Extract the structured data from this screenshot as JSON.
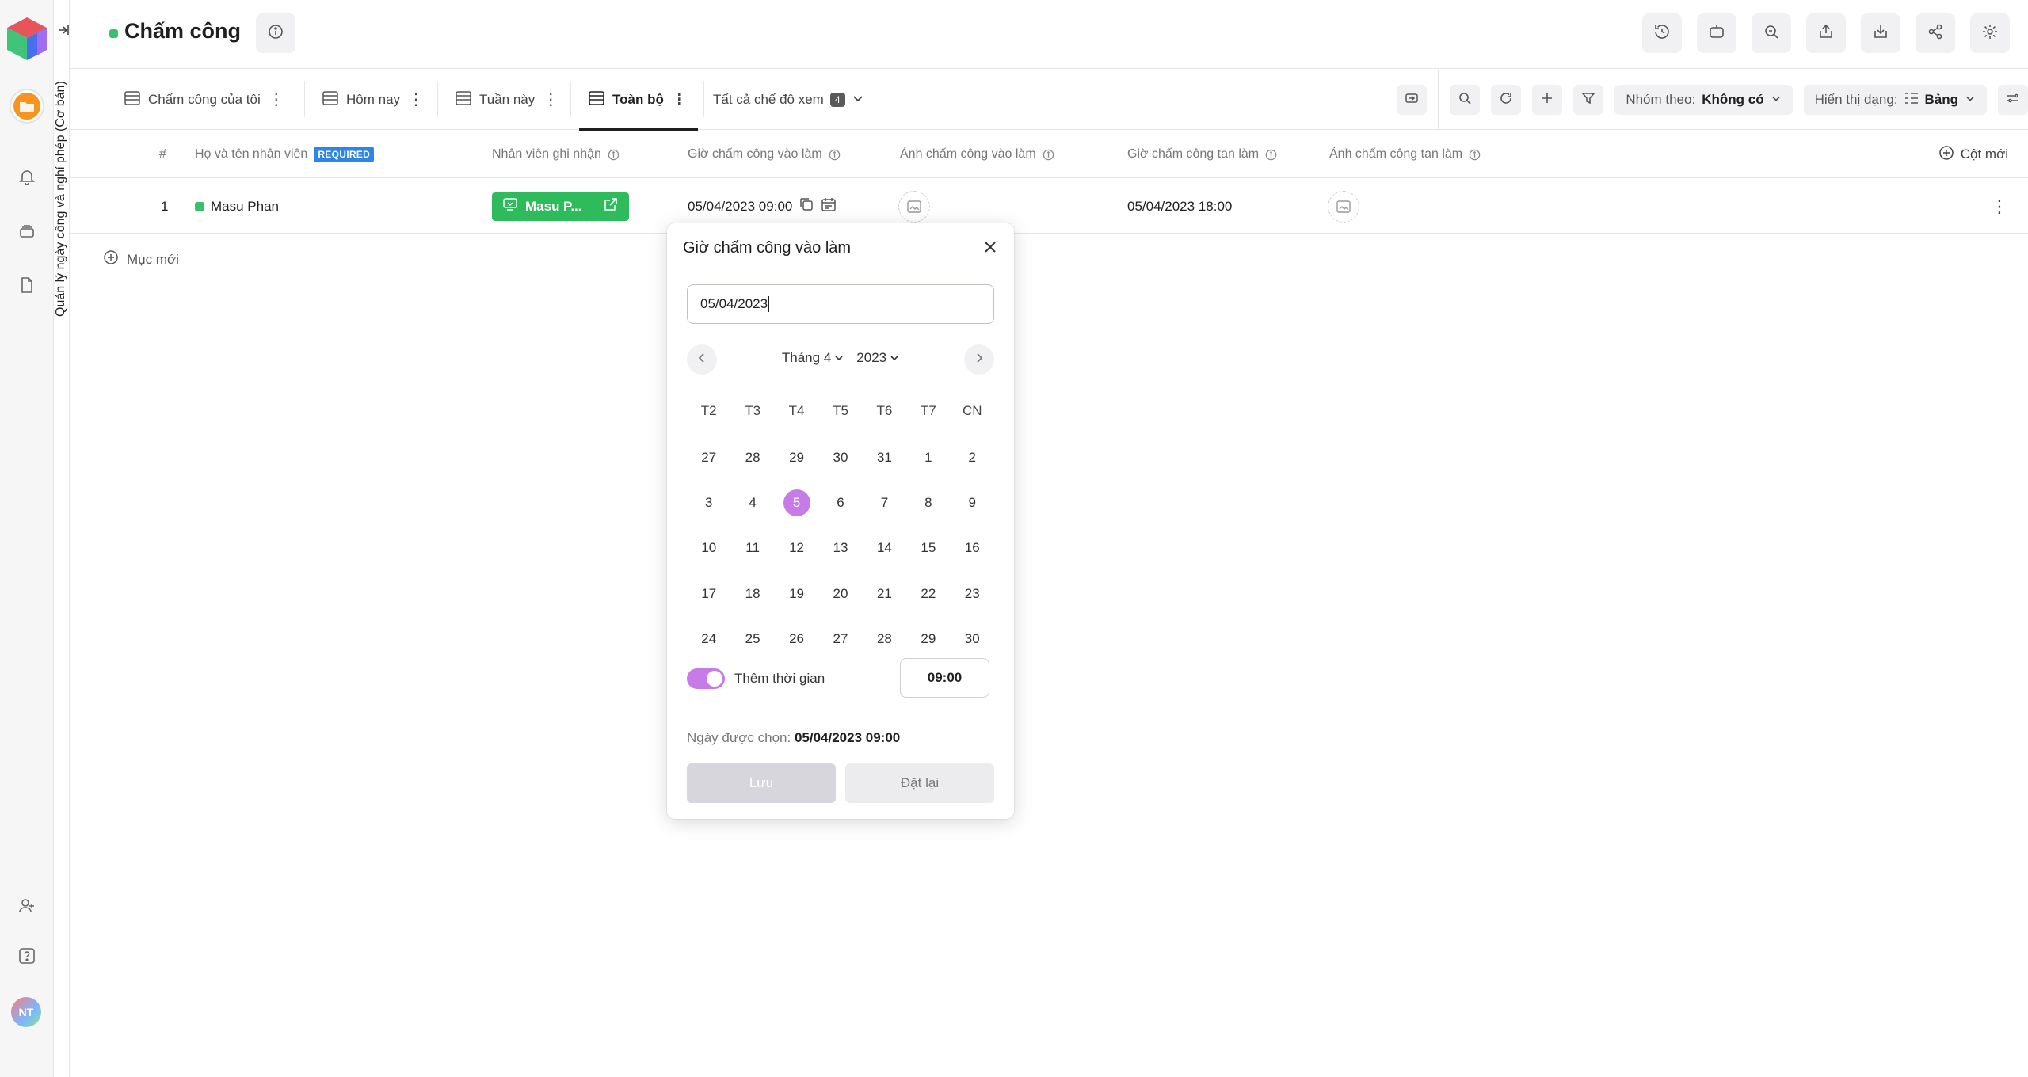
{
  "app": {
    "page_title": "Chấm công",
    "sidebar_vertical_title": "Quản lý ngày công và nghỉ phép (Cơ bản)",
    "avatar_initials": "NT"
  },
  "views": {
    "tabs": [
      {
        "label": "Chấm công của tôi"
      },
      {
        "label": "Hôm nay"
      },
      {
        "label": "Tuần này"
      },
      {
        "label": "Toàn bộ"
      }
    ],
    "all_views_label": "Tất cả chế độ xem",
    "all_views_count": "4",
    "group_by_label": "Nhóm theo:",
    "group_by_value": "Không có",
    "display_label": "Hiển thị dạng:",
    "display_value": "Bảng"
  },
  "table": {
    "columns": {
      "index": "#",
      "name": "Họ và tên nhân viên",
      "required_badge": "REQUIRED",
      "recorder": "Nhân viên ghi nhận",
      "checkin_time": "Giờ chấm công vào làm",
      "checkin_photo": "Ảnh chấm công vào làm",
      "checkout_time": "Giờ chấm công tan làm",
      "checkout_photo": "Ảnh chấm công tan làm",
      "new_column": "Cột mới"
    },
    "rows": [
      {
        "index": "1",
        "name": "Masu Phan",
        "recorder": "Masu P...",
        "checkin_time": "05/04/2023 09:00",
        "checkout_time": "05/04/2023 18:00"
      }
    ],
    "new_item_label": "Mục mới"
  },
  "date_picker": {
    "title": "Giờ chấm công vào làm",
    "input_value": "05/04/2023",
    "month_label": "Tháng 4",
    "year_label": "2023",
    "weekdays": [
      "T2",
      "T3",
      "T4",
      "T5",
      "T6",
      "T7",
      "CN"
    ],
    "weeks": [
      [
        "27",
        "28",
        "29",
        "30",
        "31",
        "1",
        "2"
      ],
      [
        "3",
        "4",
        "5",
        "6",
        "7",
        "8",
        "9"
      ],
      [
        "10",
        "11",
        "12",
        "13",
        "14",
        "15",
        "16"
      ],
      [
        "17",
        "18",
        "19",
        "20",
        "21",
        "22",
        "23"
      ],
      [
        "24",
        "25",
        "26",
        "27",
        "28",
        "29",
        "30"
      ]
    ],
    "selected_day": "5",
    "include_time_label": "Thêm thời gian",
    "include_time_on": true,
    "time_value": "09:00",
    "selected_prefix": "Ngày được chọn:",
    "selected_value": "05/04/2023 09:00",
    "save_label": "Lưu",
    "reset_label": "Đặt lại"
  },
  "colors": {
    "accent_purple": "#c77be6",
    "status_green": "#39c06e",
    "link_green": "#2ebb5c",
    "required_blue": "#2b86e6"
  }
}
